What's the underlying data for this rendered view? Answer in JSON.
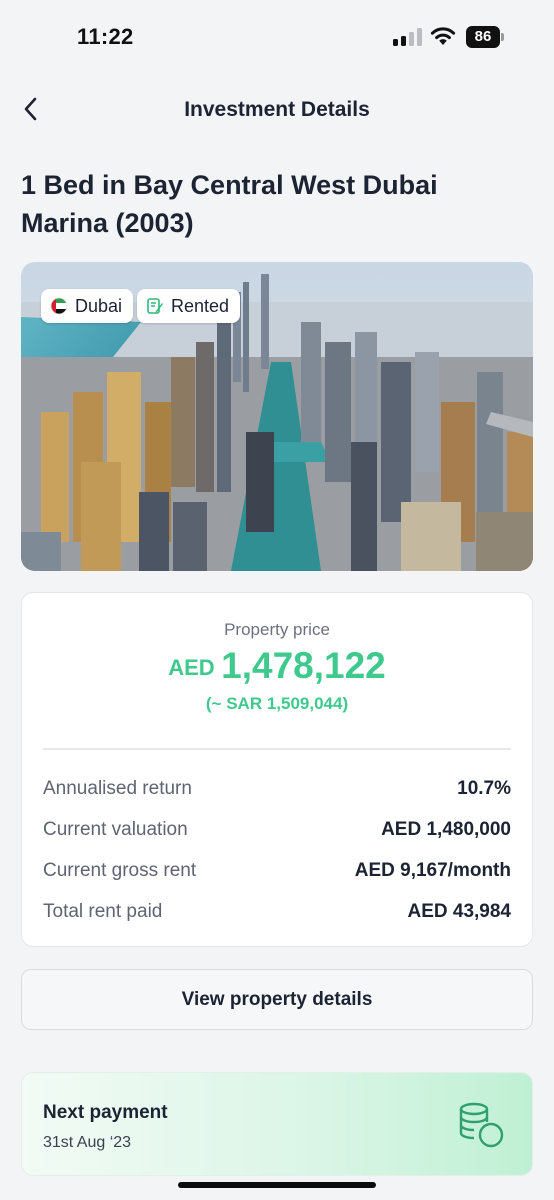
{
  "status_bar": {
    "time": "11:22",
    "battery": "86",
    "signal-icon": "cellular-signal-icon",
    "wifi-icon": "wifi-icon"
  },
  "nav": {
    "title": "Investment Details",
    "back_icon": "chevron-left-icon"
  },
  "property": {
    "title": "1 Bed in Bay Central West Dubai Marina (2003)",
    "location_chip": "Dubai",
    "location_icon": "uae-flag-icon",
    "status_chip": "Rented",
    "status_icon": "contract-icon"
  },
  "price_card": {
    "label": "Property price",
    "currency": "AED",
    "amount": "1,478,122",
    "secondary": "(~ SAR 1,509,044)",
    "stats": [
      {
        "label": "Annualised return",
        "value": "10.7%"
      },
      {
        "label": "Current valuation",
        "value": "AED 1,480,000"
      },
      {
        "label": "Current gross rent",
        "value": "AED 9,167/month"
      },
      {
        "label": "Total rent paid",
        "value": "AED 43,984"
      }
    ]
  },
  "actions": {
    "view_details": "View property details"
  },
  "next_payment": {
    "title": "Next payment",
    "date": "31st Aug ‘23",
    "icon": "coins-stack-icon"
  },
  "colors": {
    "accent_green": "#3fc98d",
    "text_dark": "#1c2333",
    "background": "#f3f4f6"
  }
}
